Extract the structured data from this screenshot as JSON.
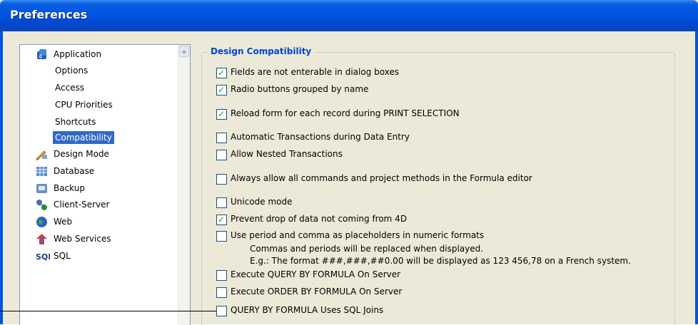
{
  "window": {
    "title": "Preferences"
  },
  "sidebar": {
    "items": [
      {
        "label": "Application",
        "icon": "application-icon",
        "level": 0
      },
      {
        "label": "Options",
        "level": 1
      },
      {
        "label": "Access",
        "level": 1
      },
      {
        "label": "CPU Priorities",
        "level": 1
      },
      {
        "label": "Shortcuts",
        "level": 1
      },
      {
        "label": "Compatibility",
        "level": 1,
        "selected": true
      },
      {
        "label": "Design Mode",
        "icon": "design-mode-icon",
        "level": 0
      },
      {
        "label": "Database",
        "icon": "database-icon",
        "level": 0
      },
      {
        "label": "Backup",
        "icon": "backup-icon",
        "level": 0
      },
      {
        "label": "Client-Server",
        "icon": "client-server-icon",
        "level": 0
      },
      {
        "label": "Web",
        "icon": "web-icon",
        "level": 0
      },
      {
        "label": "Web Services",
        "icon": "web-services-icon",
        "level": 0
      },
      {
        "label": "SQL",
        "icon": "sql-icon",
        "level": 0
      }
    ]
  },
  "section": {
    "title": "Design Compatibility",
    "options": [
      {
        "label": "Fields are not enterable in dialog boxes",
        "checked": true
      },
      {
        "label": "Radio buttons grouped by name",
        "checked": true
      },
      {
        "label": "Reload form for each record during PRINT SELECTION",
        "checked": true
      },
      {
        "label": "Automatic Transactions during Data Entry",
        "checked": false
      },
      {
        "label": "Allow Nested Transactions",
        "checked": false
      },
      {
        "label": "Always allow all commands and project methods in the Formula editor",
        "checked": false
      },
      {
        "label": "Unicode mode",
        "checked": false
      },
      {
        "label": "Prevent drop of data not coming from 4D",
        "checked": true
      },
      {
        "label": "Use period and comma as placeholders in numeric formats",
        "checked": false
      },
      {
        "label": "Execute QUERY BY FORMULA On Server",
        "checked": false
      },
      {
        "label": "Execute ORDER BY FORMULA On Server",
        "checked": false
      },
      {
        "label": "QUERY BY FORMULA Uses SQL Joins",
        "checked": false
      }
    ],
    "notes": [
      "Commas and periods will be replaced when displayed.",
      "E.g.: The format ###,###,##0.00 will be displayed as 123 456,78 on a French system."
    ]
  },
  "colors": {
    "accent": "#0046d5",
    "titlebar": "#0054e3",
    "selection": "#316ac5",
    "check": "#21a121"
  }
}
